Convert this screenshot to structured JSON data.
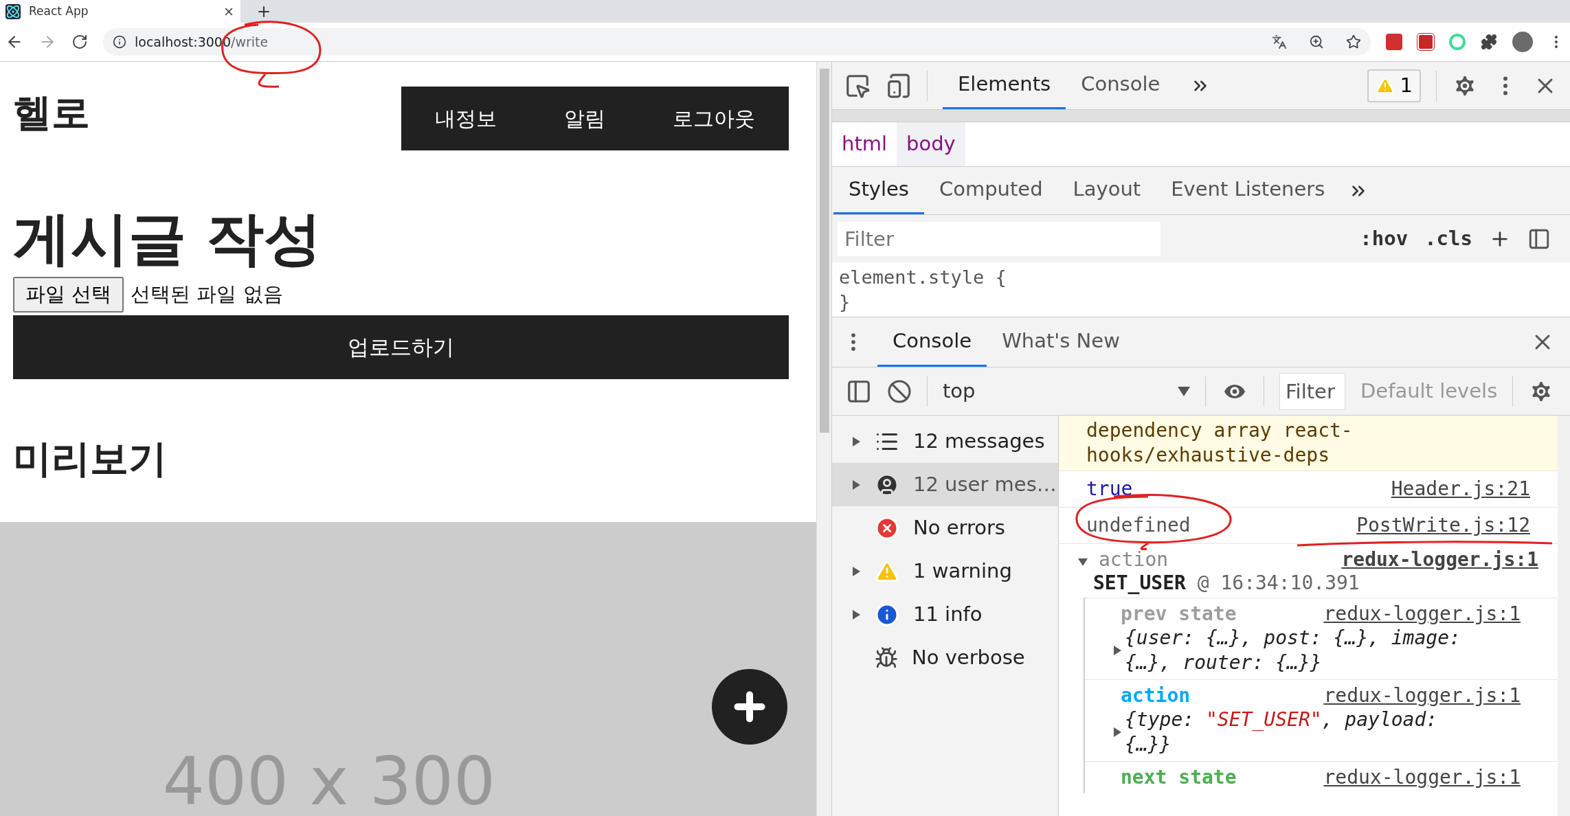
{
  "browser": {
    "tab_title": "React App",
    "url_host": "localhost:3000",
    "url_path": "/write"
  },
  "page": {
    "logo": "헬로",
    "nav": [
      "내정보",
      "알림",
      "로그아웃"
    ],
    "title": "게시글 작성",
    "file_button": "파일 선택",
    "file_status": "선택된 파일 없음",
    "upload_button": "업로드하기",
    "preview_heading": "미리보기",
    "preview_placeholder": "400 x 300"
  },
  "devtools": {
    "tabs": [
      {
        "label": "Elements",
        "selected": true
      },
      {
        "label": "Console",
        "selected": false
      }
    ],
    "warning_count": "1",
    "breadcrumbs": [
      {
        "label": "html",
        "selected": false
      },
      {
        "label": "body",
        "selected": true
      }
    ],
    "styles_tabs": [
      {
        "label": "Styles",
        "selected": true
      },
      {
        "label": "Computed",
        "selected": false
      },
      {
        "label": "Layout",
        "selected": false
      },
      {
        "label": "Event Listeners",
        "selected": false
      }
    ],
    "styles_filter": {
      "placeholder": "Filter"
    },
    "hov": ":hov",
    "cls": ".cls",
    "style_rule": "element.style {",
    "style_rule_end": "}",
    "drawer_tabs": [
      {
        "label": "Console",
        "selected": true
      },
      {
        "label": "What's New",
        "selected": false
      }
    ],
    "context": "top",
    "console_filter": {
      "placeholder": "Filter"
    },
    "levels": "Default levels",
    "sidebar": [
      {
        "kind": "messages",
        "label": "12 messages",
        "expandable": true,
        "selected": false
      },
      {
        "kind": "user",
        "label": "12 user mes…",
        "expandable": true,
        "selected": true
      },
      {
        "kind": "error",
        "label": "No errors",
        "expandable": false,
        "selected": false
      },
      {
        "kind": "warning",
        "label": "1 warning",
        "expandable": true,
        "selected": false
      },
      {
        "kind": "info",
        "label": "11 info",
        "expandable": true,
        "selected": false
      },
      {
        "kind": "verbose",
        "label": "No verbose",
        "expandable": false,
        "selected": false
      }
    ],
    "messages": [
      {
        "kind": "warning",
        "text": "dependency array  react-hooks/exhaustive-deps"
      },
      {
        "kind": "value",
        "text": "true",
        "source": "Header.js:21"
      },
      {
        "kind": "plain",
        "text": "undefined",
        "source": "PostWrite.js:12"
      },
      {
        "kind": "group",
        "expanded": true,
        "title": "action",
        "type": "SET_USER",
        "time": "@ 16:34:10.391",
        "source": "redux-logger.js:1",
        "children": [
          {
            "label": "prev state",
            "color": "#9e9e9e",
            "source": "redux-logger.js:1",
            "parts": [
              {
                "text": "{user: {…}, post: {…}, image: {…}, router: {…}}",
                "kind": "plain"
              }
            ]
          },
          {
            "label": "action",
            "color": "#03a9f4",
            "source": "redux-logger.js:1",
            "parts": [
              {
                "text": "{type: ",
                "kind": "plain"
              },
              {
                "text": "\"SET_USER\"",
                "kind": "string"
              },
              {
                "text": ", payload: {…}}",
                "kind": "plain"
              }
            ]
          },
          {
            "label": "next state",
            "color": "#4caf50",
            "source": "redux-logger.js:1"
          }
        ]
      }
    ]
  }
}
